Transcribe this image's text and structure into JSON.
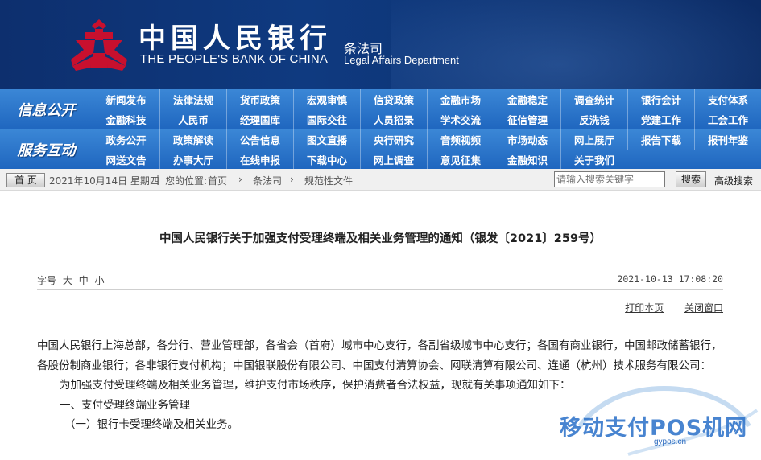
{
  "header": {
    "logo_cn": "中国人民银行",
    "logo_en": "THE PEOPLE'S BANK OF CHINA",
    "dept_cn": "条法司",
    "dept_en": "Legal Affairs Department",
    "colors": {
      "background": "#0f3a80",
      "logo_red": "#c8102e"
    }
  },
  "nav": {
    "groups": [
      {
        "label": "信息公开",
        "row1": [
          "新闻发布",
          "法律法规",
          "货币政策",
          "宏观审慎",
          "信贷政策",
          "金融市场",
          "金融稳定",
          "调查统计",
          "银行会计",
          "支付体系"
        ],
        "row2": [
          "金融科技",
          "人民币",
          "经理国库",
          "国际交往",
          "人员招录",
          "学术交流",
          "征信管理",
          "反洗钱",
          "党建工作",
          "工会工作"
        ]
      },
      {
        "label": "服务互动",
        "row1": [
          "政务公开",
          "政策解读",
          "公告信息",
          "图文直播",
          "央行研究",
          "音频视频",
          "市场动态",
          "网上展厅",
          "报告下载",
          "报刊年鉴"
        ],
        "row2": [
          "网送文告",
          "办事大厅",
          "在线申报",
          "下载中心",
          "网上调查",
          "意见征集",
          "金融知识",
          "关于我们"
        ]
      }
    ]
  },
  "breadcrumb": {
    "home": "首 页",
    "date": "2021年10月14日 星期四",
    "sep": "|",
    "location_label": "您的位置:",
    "items": [
      "首页",
      "条法司",
      "规范性文件"
    ],
    "arrow": "›",
    "search_placeholder": "请输入搜索关键字",
    "search_button": "搜索",
    "advanced": "高级搜索"
  },
  "article": {
    "title": "中国人民银行关于加强支付受理终端及相关业务管理的通知（银发〔2021〕259号）",
    "font_size_label": "字号",
    "sizes": [
      "大",
      "中",
      "小"
    ],
    "datetime": "2021-10-13 17:08:20",
    "print": "打印本页",
    "close": "关闭窗口",
    "paragraphs": [
      "中国人民银行上海总部，各分行、营业管理部，各省会（首府）城市中心支行，各副省级城市中心支行；各国有商业银行，中国邮政储蓄银行，各股份制商业银行；各非银行支付机构；中国银联股份有限公司、中国支付清算协会、网联清算有限公司、连通（杭州）技术服务有限公司：",
      "为加强支付受理终端及相关业务管理，维护支付市场秩序，保护消费者合法权益，现就有关事项通知如下：",
      "一、支付受理终端业务管理",
      "（一）银行卡受理终端及相关业务。"
    ]
  },
  "watermark": {
    "text": "移动支付POS机网",
    "url": "gypos.cn"
  }
}
